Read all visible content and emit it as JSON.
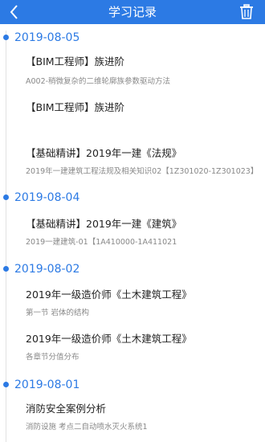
{
  "header": {
    "title": "学习记录"
  },
  "groups": [
    {
      "date": "2019-08-05",
      "items": [
        {
          "title": "【BIM工程师】族进阶",
          "subtitle": "A002-稍微复杂的二维轮廓族参数驱动方法"
        },
        {
          "title": "【BIM工程师】族进阶",
          "subtitle": ""
        },
        {
          "title": "【基础精讲】2019年一建《法规》",
          "subtitle": "2019年一建建筑工程法规及相关知识02【1Z301020-1Z301023】"
        }
      ]
    },
    {
      "date": "2019-08-04",
      "items": [
        {
          "title": "【基础精讲】2019年一建《建筑》",
          "subtitle": "2019一建建筑-01【1A410000-1A411021"
        }
      ]
    },
    {
      "date": "2019-08-02",
      "items": [
        {
          "title": "2019年一级造价师《土木建筑工程》",
          "subtitle": "第一节 岩体的结构"
        },
        {
          "title": "2019年一级造价师《土木建筑工程》",
          "subtitle": "各章节分值分布"
        }
      ]
    },
    {
      "date": "2019-08-01",
      "items": [
        {
          "title": "消防安全案例分析",
          "subtitle": "消防设施 考点二自动喷水灭火系统1"
        }
      ]
    }
  ]
}
